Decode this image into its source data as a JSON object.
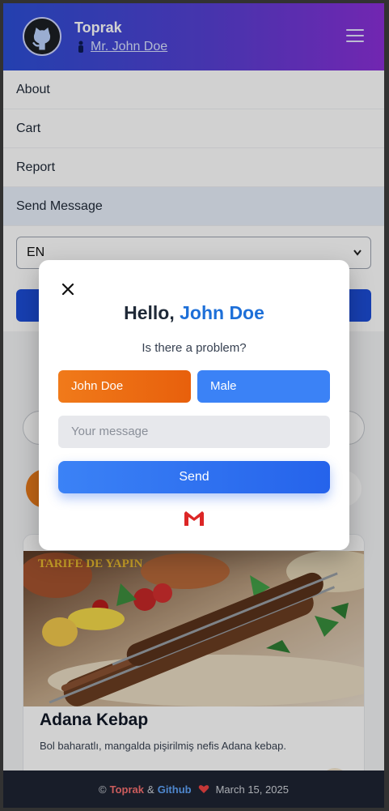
{
  "header": {
    "brand": "Toprak",
    "user": "Mr. John Doe"
  },
  "nav": {
    "items": [
      "About",
      "Cart",
      "Report",
      "Send Message"
    ],
    "active_index": 3
  },
  "language": {
    "selected": "EN"
  },
  "card": {
    "banner_text": "TARIFE DE YAPIN",
    "title": "Adana Kebap",
    "description": "Bol baharatlı, mangalda pişirilmiş nefis Adana kebap."
  },
  "footer": {
    "copyright_symbol": "©",
    "name_a": "Toprak",
    "amp": "&",
    "name_b": "Github",
    "date": "March 15, 2025"
  },
  "modal": {
    "greeting": "Hello,",
    "name": "John Doe",
    "subtitle": "Is there a problem?",
    "name_field": "John Doe",
    "gender_field": "Male",
    "message_placeholder": "Your message",
    "send_label": "Send"
  },
  "colors": {
    "accent_blue": "#3b82f6",
    "accent_orange": "#ea6a10",
    "gmail_red": "#dc2626",
    "heart_red": "#ef4444"
  },
  "icons": [
    "github-icon",
    "person-icon",
    "hamburger-menu-icon",
    "close-icon",
    "gmail-icon",
    "heart-icon",
    "chevron-down-icon"
  ]
}
